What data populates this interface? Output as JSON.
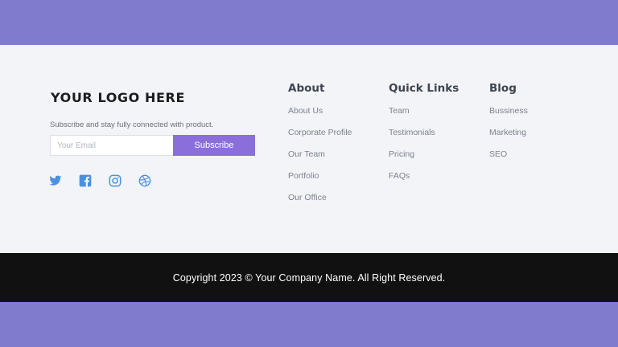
{
  "brand": {
    "logo_text": "YOUR LOGO HERE",
    "tagline": "Subscribe and stay fully connected with product."
  },
  "subscribe": {
    "placeholder": "Your Email",
    "button_label": "Subscribe"
  },
  "social": [
    {
      "icon": "twitter-icon"
    },
    {
      "icon": "facebook-icon"
    },
    {
      "icon": "instagram-icon"
    },
    {
      "icon": "dribbble-icon"
    }
  ],
  "columns": {
    "about": {
      "title": "About",
      "links": [
        "About Us",
        "Corporate Profile",
        "Our Team",
        "Portfolio",
        "Our Office"
      ]
    },
    "quick_links": {
      "title": "Quick Links",
      "links": [
        "Team",
        "Testimonials",
        "Pricing",
        "FAQs"
      ]
    },
    "blog": {
      "title": "Blog",
      "links": [
        "Bussiness",
        "Marketing",
        "SEO"
      ]
    }
  },
  "footer_bottom": {
    "copyright": "Copyright 2023 © Your Company Name. All Right Reserved."
  },
  "colors": {
    "page_band": "#807bcd",
    "footer_background": "#f2f4f7",
    "bottom_bar": "#111111",
    "accent": "#8a6fdc",
    "social_icon": "#4a90e2"
  }
}
